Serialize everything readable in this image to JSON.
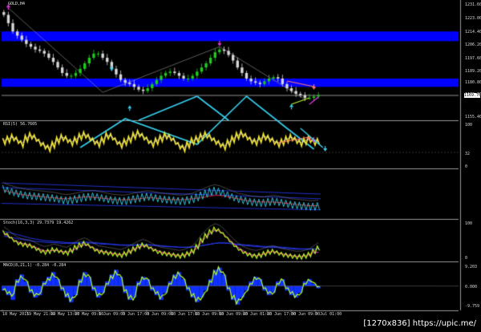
{
  "symbol": "GOLD,H4",
  "watermark": "[1270x836] https://upic.me/",
  "colors": {
    "bg": "#000000",
    "grid": "#3a3a3a",
    "bull": "#1fcc1f",
    "bear": "#d8d8d8",
    "zone": "#0000ff",
    "cyan": "#36d2f0",
    "magenta": "#e63ce6",
    "salmon": "#ff7a6a",
    "yellow": "#f5e62a",
    "rsi_line": "#e8e8e8",
    "red": "#e02020",
    "blue": "#2a3cff",
    "green": "#b4ff2a",
    "macd_bar": "#1030ff"
  },
  "chart_data": [
    {
      "type": "candlestick",
      "title": "GOLD,H4",
      "ylim": [
        1153,
        1237
      ],
      "y_ticks": [
        "1231.60",
        "1223.00",
        "1214.40",
        "1206.20",
        "1197.60",
        "1189.20",
        "1180.80",
        "1172.60",
        "1155.40"
      ],
      "current_price": "1169.76",
      "zones": [
        {
          "from": 1209,
          "to": 1216
        },
        {
          "from": 1176,
          "to": 1182
        }
      ],
      "support_line": 1169.8,
      "close": [
        1228,
        1222,
        1216,
        1213,
        1210,
        1207,
        1205,
        1203,
        1202,
        1200,
        1197,
        1194,
        1190,
        1186,
        1184,
        1184,
        1186,
        1189,
        1193,
        1197,
        1200,
        1200,
        1197,
        1194,
        1189,
        1185,
        1181,
        1179,
        1178,
        1176,
        1174,
        1173,
        1175,
        1178,
        1181,
        1184,
        1186,
        1187,
        1186,
        1184,
        1182,
        1182,
        1184,
        1187,
        1190,
        1193,
        1197,
        1201,
        1203,
        1202,
        1199,
        1195,
        1190,
        1186,
        1182,
        1180,
        1179,
        1178,
        1180,
        1182,
        1183,
        1182,
        1178,
        1175,
        1173,
        1171,
        1170,
        1168,
        1168,
        1169,
        1170
      ],
      "arrows": [
        {
          "dir": "up",
          "i": 1,
          "price": 1234
        },
        {
          "dir": "down",
          "i": 24,
          "price": 1189,
          "color": "cyan"
        },
        {
          "dir": "up",
          "i": 28,
          "price": 1161,
          "color": "cyan"
        },
        {
          "dir": "down",
          "i": 48,
          "price": 1207,
          "color": "magenta"
        },
        {
          "dir": "up",
          "i": 64,
          "price": 1162,
          "color": "cyan"
        }
      ],
      "zigzag": [
        [
          1,
          1233
        ],
        [
          22,
          1172
        ],
        [
          48,
          1205
        ],
        [
          67,
          1167
        ]
      ]
    },
    {
      "type": "line",
      "title": "RSI(5) 56.7605",
      "ylim": [
        0,
        100
      ],
      "y_ticks": [
        "100",
        "32",
        "0"
      ],
      "level": 32,
      "series": [
        {
          "values": [
            58,
            62,
            66,
            60,
            52,
            64,
            70,
            65,
            55,
            48,
            42,
            50,
            60,
            66,
            62,
            55,
            60,
            68,
            72,
            66,
            58,
            52,
            60,
            70,
            68,
            58,
            50,
            56,
            62,
            70,
            75,
            68,
            60,
            52,
            58,
            64,
            70,
            66,
            58,
            48,
            42,
            50,
            58,
            62,
            68,
            72,
            66,
            58,
            52,
            46,
            54,
            62,
            70,
            74,
            68,
            60,
            56,
            62,
            68,
            64,
            58,
            52,
            56,
            62,
            66,
            60,
            54,
            58,
            62,
            56,
            57
          ]
        }
      ]
    },
    {
      "type": "line",
      "ylim": [
        0,
        100
      ],
      "series": [
        {
          "values": [
            62,
            58,
            55,
            52,
            50,
            48,
            47,
            46,
            45,
            44,
            43,
            42,
            40,
            38,
            37,
            38,
            40,
            42,
            44,
            45,
            46,
            44,
            42,
            40,
            38,
            37,
            36,
            36,
            38,
            40,
            42,
            44,
            45,
            44,
            42,
            40,
            39,
            38,
            37,
            36,
            36,
            38,
            40,
            44,
            48,
            52,
            56,
            58,
            56,
            52,
            48,
            44,
            40,
            38,
            36,
            34,
            33,
            32,
            32,
            34,
            35,
            34,
            32,
            30,
            28,
            27,
            26,
            25,
            24,
            24,
            25
          ]
        },
        {
          "values": [
            58,
            55,
            53,
            51,
            49,
            48,
            47,
            46,
            45,
            44,
            43,
            42,
            41,
            40,
            40,
            41,
            42,
            43,
            44,
            44,
            43,
            42,
            41,
            40,
            39,
            38,
            38,
            38,
            38,
            39,
            40,
            41,
            42,
            42,
            41,
            40,
            39,
            38,
            38,
            38,
            38,
            39,
            40,
            41,
            42,
            44,
            46,
            47,
            47,
            46,
            44,
            42,
            40,
            38,
            36,
            35,
            34,
            33,
            33,
            33,
            33,
            32,
            31,
            30,
            29,
            28,
            27,
            26,
            25,
            25,
            25
          ]
        }
      ]
    },
    {
      "type": "line",
      "title": "Stoch(16,3,3) 29.7379 19.4262",
      "ylim": [
        0,
        100
      ],
      "y_ticks": [
        "100",
        "0"
      ],
      "series": [
        {
          "values": [
            70,
            62,
            52,
            44,
            40,
            38,
            36,
            30,
            24,
            20,
            22,
            26,
            24,
            20,
            18,
            24,
            32,
            38,
            42,
            36,
            28,
            22,
            20,
            18,
            16,
            14,
            12,
            16,
            22,
            28,
            34,
            38,
            34,
            28,
            22,
            18,
            16,
            14,
            12,
            10,
            12,
            16,
            22,
            34,
            50,
            62,
            72,
            78,
            74,
            64,
            52,
            40,
            30,
            22,
            16,
            12,
            10,
            12,
            16,
            20,
            22,
            18,
            14,
            12,
            10,
            8,
            8,
            10,
            14,
            22,
            30
          ]
        },
        {
          "values": [
            66,
            60,
            52,
            46,
            42,
            40,
            37,
            32,
            27,
            23,
            23,
            24,
            23,
            21,
            20,
            22,
            28,
            34,
            38,
            36,
            30,
            25,
            21,
            19,
            17,
            15,
            13,
            15,
            20,
            26,
            32,
            36,
            34,
            29,
            24,
            20,
            17,
            15,
            13,
            11,
            12,
            15,
            20,
            30,
            45,
            58,
            68,
            75,
            73,
            65,
            54,
            43,
            33,
            25,
            18,
            14,
            11,
            12,
            15,
            19,
            21,
            18,
            15,
            13,
            11,
            9,
            9,
            10,
            13,
            19,
            19
          ]
        },
        {
          "values": [
            72,
            70,
            67,
            64,
            61,
            58,
            55,
            53,
            51,
            49,
            48,
            47,
            46,
            45,
            44,
            44,
            44,
            45,
            45,
            45,
            44,
            43,
            42,
            41,
            40,
            39,
            38,
            38,
            38,
            38,
            39,
            39,
            39,
            38,
            37,
            36,
            35,
            34,
            33,
            32,
            32,
            32,
            33,
            34,
            36,
            38,
            40,
            42,
            43,
            43,
            42,
            41,
            40,
            39,
            38,
            37,
            36,
            35,
            34,
            34,
            34,
            33,
            32,
            31,
            30,
            29,
            28,
            28,
            28,
            28,
            28
          ]
        },
        {
          "values": [
            60,
            58,
            56,
            54,
            52,
            50,
            48,
            47,
            46,
            45,
            44,
            44,
            43,
            42,
            42,
            42,
            42,
            42,
            43,
            43,
            42,
            41,
            40,
            40,
            39,
            38,
            37,
            37,
            37,
            37,
            38,
            38,
            38,
            37,
            36,
            35,
            34,
            33,
            33,
            32,
            32,
            32,
            33,
            34,
            36,
            38,
            40,
            42,
            43,
            43,
            42,
            40,
            38,
            37,
            36,
            35,
            34,
            33,
            32,
            32,
            32,
            31,
            30,
            29,
            28,
            27,
            27,
            27,
            27,
            27,
            28
          ]
        }
      ]
    },
    {
      "type": "bar",
      "title": "MACD(8,21,1) -0.284 -0.284",
      "ylim": [
        -9.8,
        9.9
      ],
      "y_ticks": [
        "9.203",
        "0.000",
        "-9.759"
      ],
      "values": [
        -2,
        -4,
        -6,
        3,
        5,
        2,
        -3,
        -5,
        -4,
        2,
        4,
        6,
        3,
        -2,
        -5,
        -7,
        -4,
        3,
        6,
        4,
        -2,
        -5,
        -3,
        2,
        5,
        7,
        4,
        -3,
        -6,
        -5,
        2,
        4,
        3,
        -2,
        -4,
        -6,
        -3,
        2,
        5,
        6,
        3,
        -2,
        -5,
        -7,
        -5,
        -2,
        3,
        7,
        8,
        5,
        -2,
        -6,
        -8,
        -5,
        -2,
        2,
        4,
        3,
        -2,
        -4,
        -3,
        2,
        3,
        -2,
        -4,
        -5,
        -3,
        2,
        3,
        1,
        -1
      ],
      "series": [
        {
          "values": [
            -1.5,
            -3,
            -4,
            2,
            4,
            2.5,
            -2,
            -4,
            -3.5,
            1,
            3,
            5,
            3.5,
            -1,
            -4,
            -6,
            -4.5,
            2,
            5,
            4.5,
            -1,
            -4,
            -3.5,
            1,
            4,
            6,
            4.5,
            -2,
            -5,
            -5.5,
            1,
            3.5,
            3.2,
            -1,
            -3,
            -5,
            -3.5,
            1,
            4,
            5.5,
            3.5,
            -1,
            -4,
            -6,
            -5.5,
            -2.5,
            2,
            6,
            7.5,
            5.5,
            -1,
            -5,
            -7,
            -5.5,
            -2.5,
            1,
            3.5,
            3.2,
            -1,
            -3,
            -3.2,
            1,
            2.8,
            -1,
            -3,
            -4.5,
            -3.5,
            1,
            2.6,
            1.5,
            -0.3
          ]
        }
      ]
    }
  ],
  "x_axis": {
    "labels": [
      "18 May 2015",
      "19 May 21:00",
      "22 May 13:00",
      "27 May 09:00",
      "1 Jun 09:00",
      "3 Jun 17:00",
      "8 Jun 09:00",
      "10 Jun 17:00",
      "15 Jun 09:00",
      "18 Jun 09:00",
      "23 Jun 01:00",
      "25 Jun 17:00",
      "30 Jun 09:00",
      "3 Jul 01:00"
    ]
  }
}
